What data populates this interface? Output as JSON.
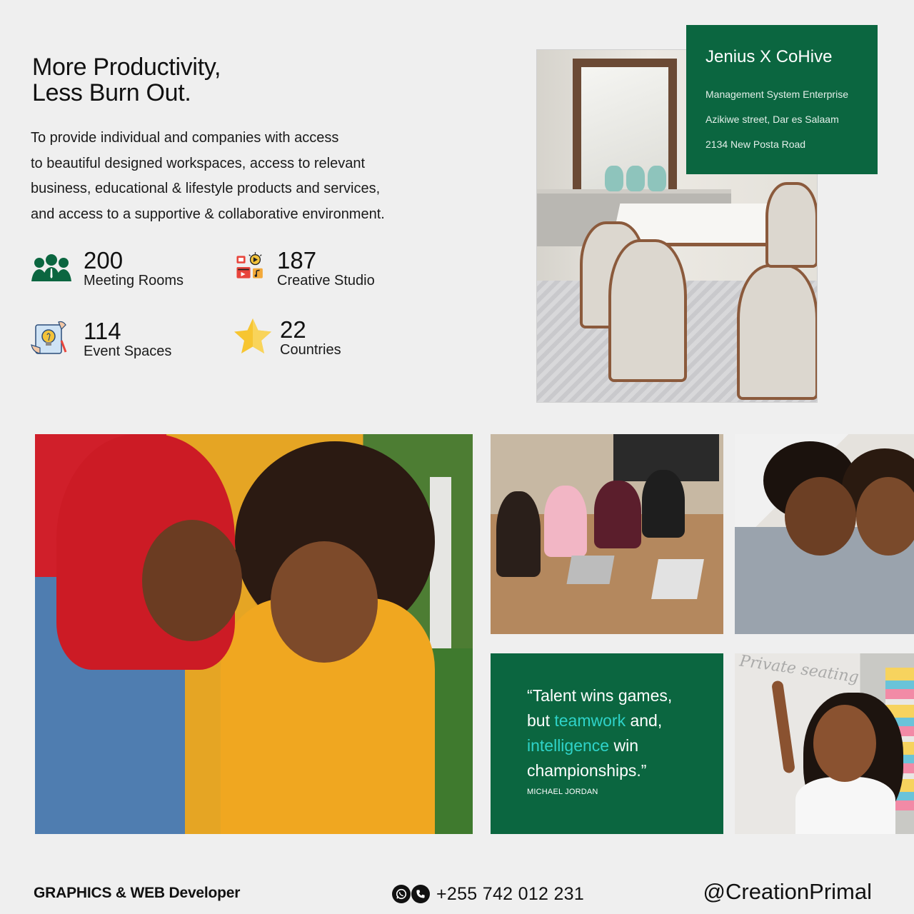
{
  "headline": {
    "line1": "More Productivity,",
    "line2": "Less Burn Out."
  },
  "intro": {
    "lines": [
      "To provide individual and companies with access",
      "to beautiful designed workspaces, access to relevant",
      "business, educational & lifestyle products and services,",
      "and access to a supportive & collaborative environment."
    ]
  },
  "stats": [
    {
      "value": "200",
      "label": "Meeting Rooms",
      "icon": "people-group-icon"
    },
    {
      "value": "187",
      "label": "Creative Studio",
      "icon": "media-creative-icon"
    },
    {
      "value": "114",
      "label": "Event Spaces",
      "icon": "idea-hands-icon"
    },
    {
      "value": "22",
      "label": "Countries",
      "icon": "star-icon"
    }
  ],
  "info_card": {
    "title": "Jenius X CoHive",
    "lines": [
      "Management System Enterprise",
      "Azikiwe street, Dar es Salaam",
      "2134 New Posta Road"
    ]
  },
  "quote": {
    "line1": "“Talent wins games,",
    "line2_pre": "but ",
    "line2_accent": "teamwork",
    "line2_post": " and,",
    "line3_accent": "intelligence",
    "line3_post": " win",
    "line4": "championships.”",
    "author": "MICHAEL JORDAN"
  },
  "board_text": "Private seating",
  "footer": {
    "left": "GRAPHICS & WEB Developer",
    "phone": "+255 742 012 231",
    "handle": "@CreationPrimal",
    "icons": [
      "whatsapp-icon",
      "phone-icon"
    ]
  },
  "colors": {
    "brand_green": "#0b6640",
    "accent_teal": "#2fd3c9",
    "background": "#efefef"
  }
}
